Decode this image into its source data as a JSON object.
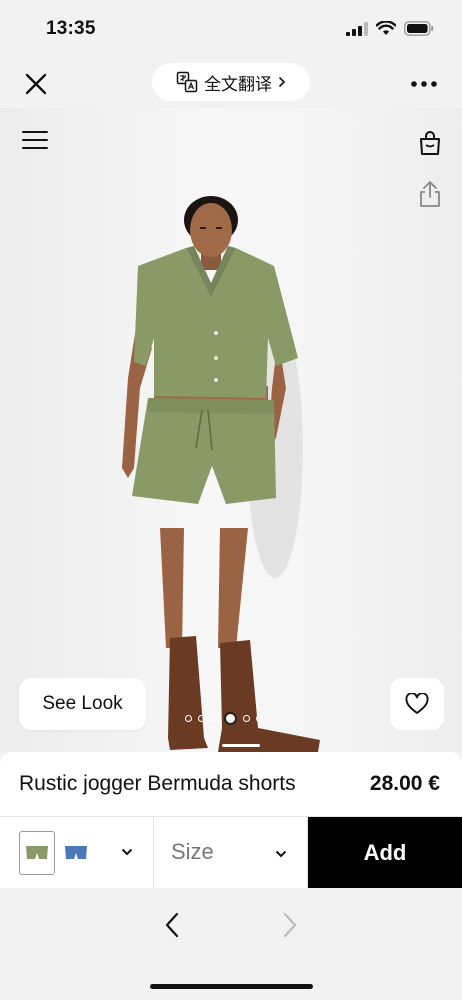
{
  "status_bar": {
    "time": "13:35",
    "icons": [
      "cellular-signal-icon",
      "wifi-icon",
      "battery-icon"
    ]
  },
  "browser_bar": {
    "close_icon": "close-icon",
    "translate_label": "全文翻译",
    "more_icon": "more-icon"
  },
  "hero": {
    "see_look_label": "See Look",
    "carousel": {
      "count": 6,
      "active_index": 3
    },
    "icons": [
      "menu-icon",
      "shopping-bag-icon",
      "share-icon",
      "heart-icon"
    ]
  },
  "product": {
    "name": "Rustic jogger Bermuda shorts",
    "price": "28.00 €",
    "colors": [
      {
        "name": "khaki-green",
        "hex": "#8a9a66",
        "selected": true
      },
      {
        "name": "denim-blue",
        "hex": "#4a78b8",
        "selected": false
      }
    ],
    "size_placeholder": "Size",
    "add_label": "Add"
  },
  "navigation": {
    "back_enabled": true,
    "forward_enabled": false
  },
  "colors": {
    "background": "#f2f2f2",
    "accent": "#000000",
    "outfit": "#8a9a66",
    "boots": "#6b3a22"
  }
}
